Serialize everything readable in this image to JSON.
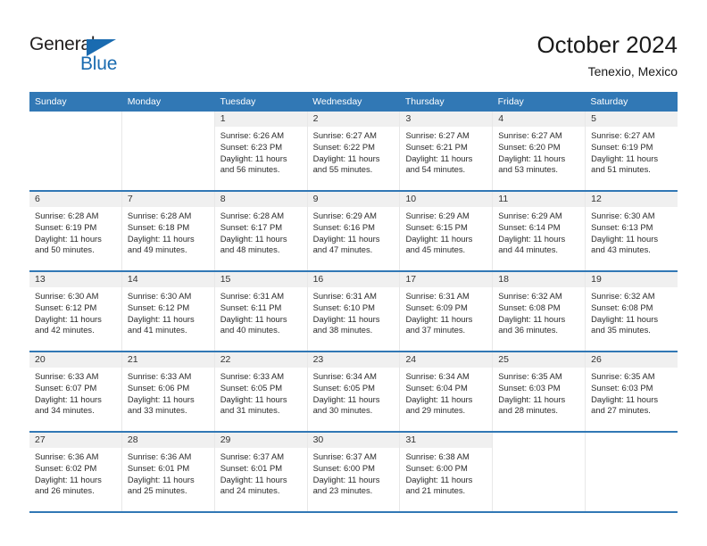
{
  "brand": {
    "name_part1": "General",
    "name_part2": "Blue",
    "triangle_color": "#1a6bb0"
  },
  "header": {
    "title": "October 2024",
    "subtitle": "Tenexio, Mexico"
  },
  "colors": {
    "header_blue": "#3178b5",
    "daynum_band": "#f0f0f0",
    "text": "#2b2b2b"
  },
  "weekdays": [
    "Sunday",
    "Monday",
    "Tuesday",
    "Wednesday",
    "Thursday",
    "Friday",
    "Saturday"
  ],
  "weeks": [
    [
      {
        "day": "",
        "lines": []
      },
      {
        "day": "",
        "lines": []
      },
      {
        "day": "1",
        "lines": [
          "Sunrise: 6:26 AM",
          "Sunset: 6:23 PM",
          "Daylight: 11 hours",
          "and 56 minutes."
        ]
      },
      {
        "day": "2",
        "lines": [
          "Sunrise: 6:27 AM",
          "Sunset: 6:22 PM",
          "Daylight: 11 hours",
          "and 55 minutes."
        ]
      },
      {
        "day": "3",
        "lines": [
          "Sunrise: 6:27 AM",
          "Sunset: 6:21 PM",
          "Daylight: 11 hours",
          "and 54 minutes."
        ]
      },
      {
        "day": "4",
        "lines": [
          "Sunrise: 6:27 AM",
          "Sunset: 6:20 PM",
          "Daylight: 11 hours",
          "and 53 minutes."
        ]
      },
      {
        "day": "5",
        "lines": [
          "Sunrise: 6:27 AM",
          "Sunset: 6:19 PM",
          "Daylight: 11 hours",
          "and 51 minutes."
        ]
      }
    ],
    [
      {
        "day": "6",
        "lines": [
          "Sunrise: 6:28 AM",
          "Sunset: 6:19 PM",
          "Daylight: 11 hours",
          "and 50 minutes."
        ]
      },
      {
        "day": "7",
        "lines": [
          "Sunrise: 6:28 AM",
          "Sunset: 6:18 PM",
          "Daylight: 11 hours",
          "and 49 minutes."
        ]
      },
      {
        "day": "8",
        "lines": [
          "Sunrise: 6:28 AM",
          "Sunset: 6:17 PM",
          "Daylight: 11 hours",
          "and 48 minutes."
        ]
      },
      {
        "day": "9",
        "lines": [
          "Sunrise: 6:29 AM",
          "Sunset: 6:16 PM",
          "Daylight: 11 hours",
          "and 47 minutes."
        ]
      },
      {
        "day": "10",
        "lines": [
          "Sunrise: 6:29 AM",
          "Sunset: 6:15 PM",
          "Daylight: 11 hours",
          "and 45 minutes."
        ]
      },
      {
        "day": "11",
        "lines": [
          "Sunrise: 6:29 AM",
          "Sunset: 6:14 PM",
          "Daylight: 11 hours",
          "and 44 minutes."
        ]
      },
      {
        "day": "12",
        "lines": [
          "Sunrise: 6:30 AM",
          "Sunset: 6:13 PM",
          "Daylight: 11 hours",
          "and 43 minutes."
        ]
      }
    ],
    [
      {
        "day": "13",
        "lines": [
          "Sunrise: 6:30 AM",
          "Sunset: 6:12 PM",
          "Daylight: 11 hours",
          "and 42 minutes."
        ]
      },
      {
        "day": "14",
        "lines": [
          "Sunrise: 6:30 AM",
          "Sunset: 6:12 PM",
          "Daylight: 11 hours",
          "and 41 minutes."
        ]
      },
      {
        "day": "15",
        "lines": [
          "Sunrise: 6:31 AM",
          "Sunset: 6:11 PM",
          "Daylight: 11 hours",
          "and 40 minutes."
        ]
      },
      {
        "day": "16",
        "lines": [
          "Sunrise: 6:31 AM",
          "Sunset: 6:10 PM",
          "Daylight: 11 hours",
          "and 38 minutes."
        ]
      },
      {
        "day": "17",
        "lines": [
          "Sunrise: 6:31 AM",
          "Sunset: 6:09 PM",
          "Daylight: 11 hours",
          "and 37 minutes."
        ]
      },
      {
        "day": "18",
        "lines": [
          "Sunrise: 6:32 AM",
          "Sunset: 6:08 PM",
          "Daylight: 11 hours",
          "and 36 minutes."
        ]
      },
      {
        "day": "19",
        "lines": [
          "Sunrise: 6:32 AM",
          "Sunset: 6:08 PM",
          "Daylight: 11 hours",
          "and 35 minutes."
        ]
      }
    ],
    [
      {
        "day": "20",
        "lines": [
          "Sunrise: 6:33 AM",
          "Sunset: 6:07 PM",
          "Daylight: 11 hours",
          "and 34 minutes."
        ]
      },
      {
        "day": "21",
        "lines": [
          "Sunrise: 6:33 AM",
          "Sunset: 6:06 PM",
          "Daylight: 11 hours",
          "and 33 minutes."
        ]
      },
      {
        "day": "22",
        "lines": [
          "Sunrise: 6:33 AM",
          "Sunset: 6:05 PM",
          "Daylight: 11 hours",
          "and 31 minutes."
        ]
      },
      {
        "day": "23",
        "lines": [
          "Sunrise: 6:34 AM",
          "Sunset: 6:05 PM",
          "Daylight: 11 hours",
          "and 30 minutes."
        ]
      },
      {
        "day": "24",
        "lines": [
          "Sunrise: 6:34 AM",
          "Sunset: 6:04 PM",
          "Daylight: 11 hours",
          "and 29 minutes."
        ]
      },
      {
        "day": "25",
        "lines": [
          "Sunrise: 6:35 AM",
          "Sunset: 6:03 PM",
          "Daylight: 11 hours",
          "and 28 minutes."
        ]
      },
      {
        "day": "26",
        "lines": [
          "Sunrise: 6:35 AM",
          "Sunset: 6:03 PM",
          "Daylight: 11 hours",
          "and 27 minutes."
        ]
      }
    ],
    [
      {
        "day": "27",
        "lines": [
          "Sunrise: 6:36 AM",
          "Sunset: 6:02 PM",
          "Daylight: 11 hours",
          "and 26 minutes."
        ]
      },
      {
        "day": "28",
        "lines": [
          "Sunrise: 6:36 AM",
          "Sunset: 6:01 PM",
          "Daylight: 11 hours",
          "and 25 minutes."
        ]
      },
      {
        "day": "29",
        "lines": [
          "Sunrise: 6:37 AM",
          "Sunset: 6:01 PM",
          "Daylight: 11 hours",
          "and 24 minutes."
        ]
      },
      {
        "day": "30",
        "lines": [
          "Sunrise: 6:37 AM",
          "Sunset: 6:00 PM",
          "Daylight: 11 hours",
          "and 23 minutes."
        ]
      },
      {
        "day": "31",
        "lines": [
          "Sunrise: 6:38 AM",
          "Sunset: 6:00 PM",
          "Daylight: 11 hours",
          "and 21 minutes."
        ]
      },
      {
        "day": "",
        "lines": []
      },
      {
        "day": "",
        "lines": []
      }
    ]
  ]
}
